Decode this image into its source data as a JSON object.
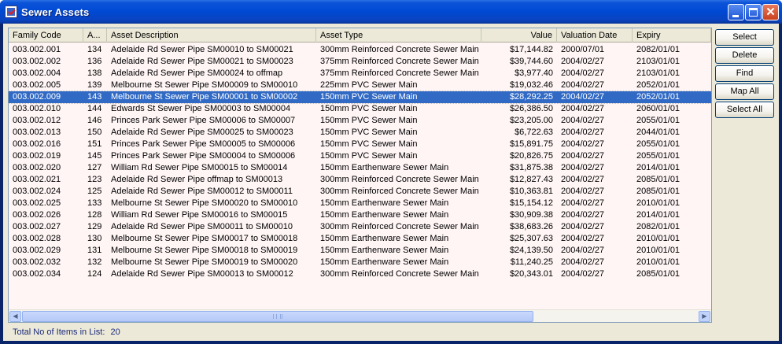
{
  "window": {
    "title": "Sewer Assets"
  },
  "columns": [
    {
      "label": "Family Code"
    },
    {
      "label": "A..."
    },
    {
      "label": "Asset Description"
    },
    {
      "label": "Asset Type"
    },
    {
      "label": "Value"
    },
    {
      "label": "Valuation Date"
    },
    {
      "label": "Expiry"
    }
  ],
  "rows": [
    [
      "003.002.001",
      "134",
      "Adelaide Rd Sewer Pipe SM00010 to SM00021",
      "300mm Reinforced Concrete Sewer Main",
      "$17,144.82",
      "2000/07/01",
      "2082/01/01"
    ],
    [
      "003.002.002",
      "136",
      "Adelaide Rd Sewer Pipe SM00021 to SM00023",
      "375mm Reinforced Concrete Sewer Main",
      "$39,744.60",
      "2004/02/27",
      "2103/01/01"
    ],
    [
      "003.002.004",
      "138",
      "Adelaide Rd Sewer Pipe SM00024 to offmap",
      "375mm Reinforced Concrete Sewer Main",
      "$3,977.40",
      "2004/02/27",
      "2103/01/01"
    ],
    [
      "003.002.005",
      "139",
      "Melbourne St Sewer Pipe SM00009 to SM00010",
      "225mm PVC Sewer Main",
      "$19,032.46",
      "2004/02/27",
      "2052/01/01"
    ],
    [
      "003.002.009",
      "143",
      "Melbourne St Sewer Pipe SM00001 to SM00002",
      "150mm PVC Sewer Main",
      "$28,292.25",
      "2004/02/27",
      "2052/01/01"
    ],
    [
      "003.002.010",
      "144",
      "Edwards St Sewer Pipe SM00003 to SM00004",
      "150mm PVC Sewer Main",
      "$26,386.50",
      "2004/02/27",
      "2060/01/01"
    ],
    [
      "003.002.012",
      "146",
      "Princes Park Sewer Pipe SM00006 to SM00007",
      "150mm PVC Sewer Main",
      "$23,205.00",
      "2004/02/27",
      "2055/01/01"
    ],
    [
      "003.002.013",
      "150",
      "Adelaide Rd Sewer Pipe SM00025 to SM00023",
      "150mm PVC Sewer Main",
      "$6,722.63",
      "2004/02/27",
      "2044/01/01"
    ],
    [
      "003.002.016",
      "151",
      "Princes Park Sewer Pipe SM00005 to SM00006",
      "150mm PVC Sewer Main",
      "$15,891.75",
      "2004/02/27",
      "2055/01/01"
    ],
    [
      "003.002.019",
      "145",
      "Princes Park Sewer Pipe SM00004 to SM00006",
      "150mm PVC Sewer Main",
      "$20,826.75",
      "2004/02/27",
      "2055/01/01"
    ],
    [
      "003.002.020",
      "127",
      "William Rd Sewer Pipe SM00015 to SM00014",
      "150mm Earthenware Sewer Main",
      "$31,875.38",
      "2004/02/27",
      "2014/01/01"
    ],
    [
      "003.002.021",
      "123",
      "Adelaide Rd Sewer Pipe offmap to SM00013",
      "300mm Reinforced Concrete Sewer Main",
      "$12,827.43",
      "2004/02/27",
      "2085/01/01"
    ],
    [
      "003.002.024",
      "125",
      "Adelaide Rd Sewer Pipe SM00012 to SM00011",
      "300mm Reinforced Concrete Sewer Main",
      "$10,363.81",
      "2004/02/27",
      "2085/01/01"
    ],
    [
      "003.002.025",
      "133",
      "Melbourne St Sewer Pipe SM00020 to SM00010",
      "150mm Earthenware Sewer Main",
      "$15,154.12",
      "2004/02/27",
      "2010/01/01"
    ],
    [
      "003.002.026",
      "128",
      "William Rd Sewer Pipe SM00016 to SM00015",
      "150mm Earthenware Sewer Main",
      "$30,909.38",
      "2004/02/27",
      "2014/01/01"
    ],
    [
      "003.002.027",
      "129",
      "Adelaide Rd Sewer Pipe SM00011 to SM00010",
      "300mm Reinforced Concrete Sewer Main",
      "$38,683.26",
      "2004/02/27",
      "2082/01/01"
    ],
    [
      "003.002.028",
      "130",
      "Melbourne St Sewer Pipe SM00017 to SM00018",
      "150mm Earthenware Sewer Main",
      "$25,307.63",
      "2004/02/27",
      "2010/01/01"
    ],
    [
      "003.002.029",
      "131",
      "Melbourne St Sewer Pipe SM00018 to SM00019",
      "150mm Earthenware Sewer Main",
      "$24,139.50",
      "2004/02/27",
      "2010/01/01"
    ],
    [
      "003.002.032",
      "132",
      "Melbourne St Sewer Pipe SM00019 to SM00020",
      "150mm Earthenware Sewer Main",
      "$11,240.25",
      "2004/02/27",
      "2010/01/01"
    ],
    [
      "003.002.034",
      "124",
      "Adelaide Rd Sewer Pipe SM00013 to SM00012",
      "300mm Reinforced Concrete Sewer Main",
      "$20,343.01",
      "2004/02/27",
      "2085/01/01"
    ]
  ],
  "selected_row": 4,
  "buttons": {
    "select": "Select",
    "delete": "Delete",
    "find": "Find",
    "map_all": "Map All",
    "select_all": "Select All"
  },
  "footer": {
    "label": "Total No of Items in List:",
    "count": "20"
  },
  "colors": {
    "titlebar": "#0049d3",
    "selection": "#316ac5",
    "list_bg": "#fff5f5",
    "client_bg": "#ece9d8"
  },
  "icons": [
    "app-icon",
    "minimize-icon",
    "maximize-icon",
    "close-icon",
    "scroll-left-icon",
    "scroll-right-icon"
  ]
}
